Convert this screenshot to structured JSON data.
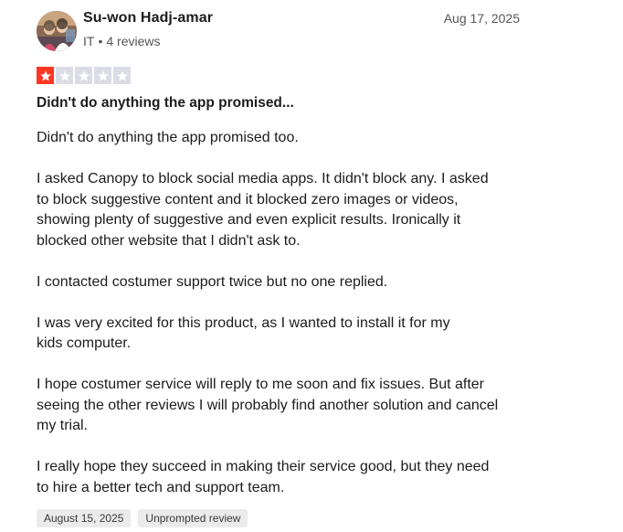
{
  "review": {
    "author": {
      "name": "Su-won Hadj-amar",
      "country": "IT",
      "separator": "•",
      "review_count": "4 reviews",
      "avatar": "avatar-photo"
    },
    "date": "Aug 17, 2025",
    "rating": 1,
    "rating_max": 5,
    "title": "Didn't do anything the app promised...",
    "paragraphs": [
      "Didn't do anything the app promised too.",
      "I asked Canopy to block social media apps. It didn't block any. I asked\nto block suggestive content and it blocked zero images or videos,\nshowing plenty of suggestive and even explicit results. Ironically it\nblocked other website that I didn't ask to.",
      "I contacted costumer support twice but no one replied.",
      "I was very excited for this product, as I wanted to install it for my\nkids computer.",
      "I hope costumer service will reply to me soon and fix issues. But after\nseeing the other reviews I will probably find another solution and cancel\nmy trial.",
      "I really hope they succeed in making their service good, but they need\nto hire a better tech and support team."
    ],
    "tags": {
      "experience_date": "August 15, 2025",
      "review_type": "Unprompted review"
    }
  },
  "colors": {
    "star_filled": "#ff3722",
    "star_empty": "#dcdce6",
    "tag_bg": "#ebebeb"
  }
}
